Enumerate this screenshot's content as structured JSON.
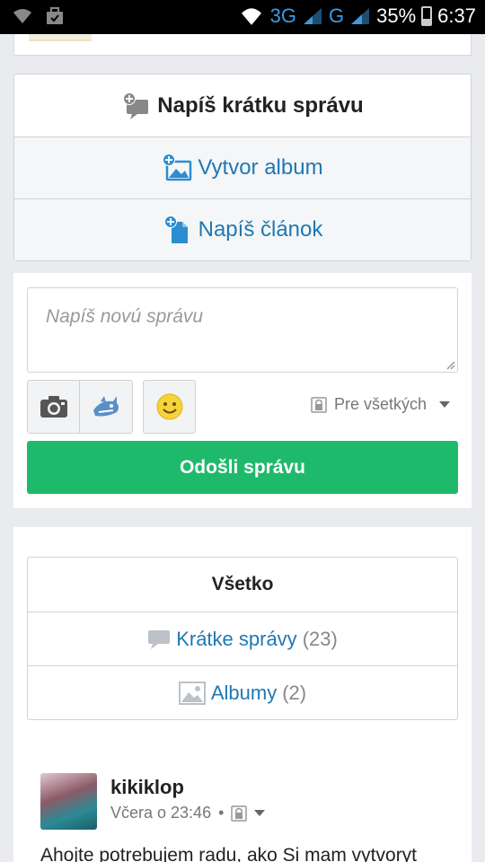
{
  "status_bar": {
    "network_1": "3G",
    "network_2": "G",
    "battery": "35%",
    "time": "6:37"
  },
  "actions": [
    {
      "label": "Napíš krátku správu",
      "icon": "add-comment-icon"
    },
    {
      "label": "Vytvor album",
      "icon": "add-image-icon"
    },
    {
      "label": "Napíš článok",
      "icon": "add-document-icon"
    }
  ],
  "composer": {
    "placeholder": "Napíš novú správu",
    "privacy": "Pre všetkých",
    "send_label": "Odošli správu"
  },
  "filters": {
    "all": "Všetko",
    "short_messages": {
      "label": "Krátke správy",
      "count": "(23)"
    },
    "albums": {
      "label": "Albumy",
      "count": "(2)"
    }
  },
  "post": {
    "author": "kikiklop",
    "time": "Včera o 23:46",
    "separator": "•",
    "text": "Ahojte potrebujem radu, ako Si mam vytvoryt"
  },
  "colors": {
    "link": "#1f78b4",
    "send_button": "#1fb96c"
  }
}
